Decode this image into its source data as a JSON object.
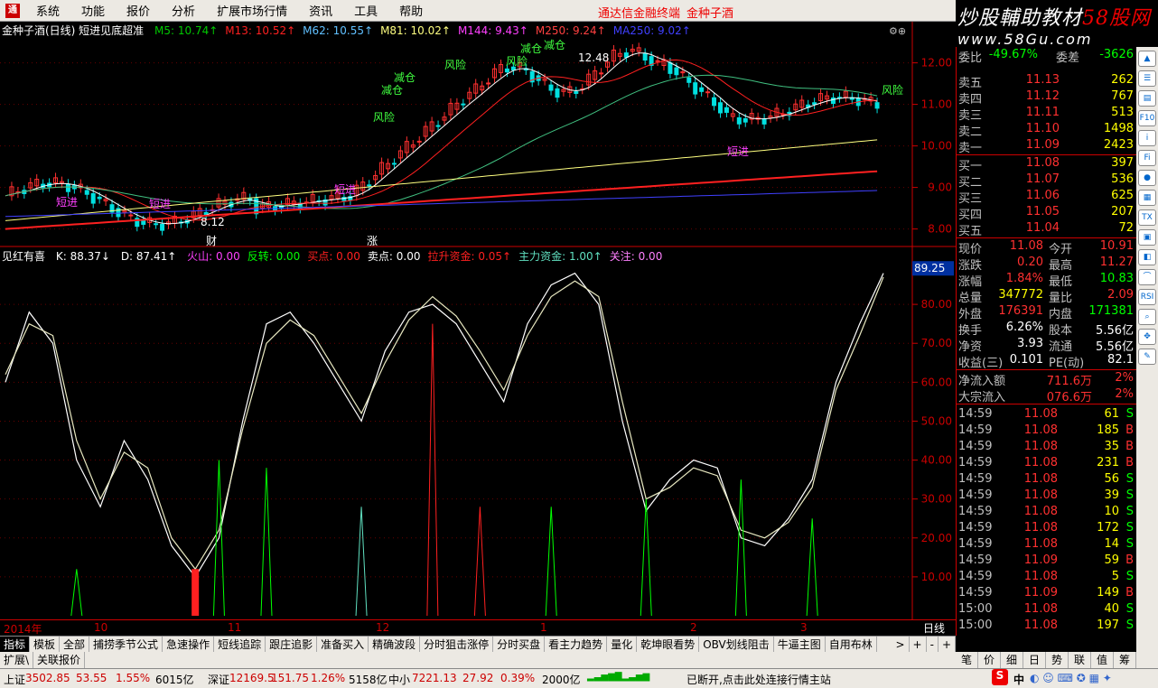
{
  "menu": {
    "logo": "通",
    "items": [
      "系统",
      "功能",
      "报价",
      "分析",
      "扩展市场行情",
      "资讯",
      "工具",
      "帮助"
    ],
    "center_text": "通达信金融终端",
    "stock_name": "金种子酒"
  },
  "watermark": {
    "line1": "炒股輔助教材",
    "line1_accent": "58股网",
    "line2": "www.58Gu.com"
  },
  "main_chart": {
    "title": "金种子酒(日线) 短进见底超准",
    "ma": [
      {
        "label": "M5: 10.74",
        "color": "#00c800"
      },
      {
        "label": "M13: 10.52",
        "color": "#ff2020"
      },
      {
        "label": "M62: 10.55",
        "color": "#60c0ff"
      },
      {
        "label": "M81: 10.02",
        "color": "#ffff80"
      },
      {
        "label": "M144: 9.43",
        "color": "#ff40ff"
      },
      {
        "label": "M250: 9.24",
        "color": "#ff4040"
      },
      {
        "label": "MA250: 9.02",
        "color": "#4040ff"
      }
    ],
    "price_axis": [
      "12.00",
      "11.00",
      "10.00",
      "9.00",
      "8.00"
    ],
    "annotations": {
      "high_label": "12.48",
      "low_label": "8.12",
      "risk1": "风险",
      "risk2": "风险",
      "risk3": "风险",
      "risk4": "风险",
      "reduce1": "减仓",
      "reduce2": "减仓",
      "reduce3": "减仓",
      "reduce4": "减仓",
      "short1": "短进",
      "short2": "短进",
      "short3": "短进",
      "short4": "短进",
      "cai": "财",
      "zhang": "涨"
    }
  },
  "indicator": {
    "name": "见红有喜",
    "k": "K: 88.37↓",
    "d": "D: 87.41↑",
    "items": [
      {
        "label": "火山: 0.00",
        "color": "#ff40ff"
      },
      {
        "label": "反转: 0.00",
        "color": "#00ff00"
      },
      {
        "label": "买点: 0.00",
        "color": "#ff2020"
      },
      {
        "label": "卖点: 0.00",
        "color": "#ffffff"
      },
      {
        "label": "拉升资金: 0.05↑",
        "color": "#ff2020"
      },
      {
        "label": "主力资金: 1.00↑",
        "color": "#60e0c0"
      },
      {
        "label": "关注: 0.00",
        "color": "#ff80ff"
      }
    ],
    "axis": [
      "80.00",
      "70.00",
      "60.00",
      "50.00",
      "40.00",
      "30.00",
      "20.00",
      "10.00"
    ],
    "current": "89.25"
  },
  "chart_data": {
    "type": "line",
    "title": "金种子酒(日线)",
    "series": [
      {
        "name": "K",
        "values": [
          60,
          78,
          70,
          40,
          28,
          45,
          35,
          18,
          10,
          20,
          50,
          75,
          78,
          70,
          60,
          50,
          68,
          78,
          80,
          75,
          65,
          55,
          75,
          85,
          88,
          80,
          50,
          27,
          35,
          40,
          38,
          20,
          18,
          25,
          35,
          60,
          75,
          88
        ]
      },
      {
        "name": "D",
        "values": [
          62,
          75,
          72,
          45,
          30,
          42,
          38,
          20,
          12,
          22,
          48,
          70,
          76,
          72,
          62,
          52,
          65,
          76,
          82,
          77,
          68,
          58,
          72,
          82,
          86,
          82,
          55,
          30,
          33,
          38,
          36,
          22,
          20,
          24,
          33,
          58,
          72,
          87
        ]
      }
    ],
    "ylim": [
      0,
      90
    ]
  },
  "quote": {
    "header": {
      "l1": "委比",
      "v1": "-49.67%",
      "l2": "委差",
      "v2": "-3626"
    },
    "sell": [
      {
        "label": "卖五",
        "price": "11.13",
        "vol": "262"
      },
      {
        "label": "卖四",
        "price": "11.12",
        "vol": "767"
      },
      {
        "label": "卖三",
        "price": "11.11",
        "vol": "513"
      },
      {
        "label": "卖二",
        "price": "11.10",
        "vol": "1498"
      },
      {
        "label": "卖一",
        "price": "11.09",
        "vol": "2423"
      }
    ],
    "buy": [
      {
        "label": "买一",
        "price": "11.08",
        "vol": "397"
      },
      {
        "label": "买二",
        "price": "11.07",
        "vol": "536"
      },
      {
        "label": "买三",
        "price": "11.06",
        "vol": "625"
      },
      {
        "label": "买四",
        "price": "11.05",
        "vol": "207"
      },
      {
        "label": "买五",
        "price": "11.04",
        "vol": "72"
      }
    ],
    "stats": [
      {
        "l1": "现价",
        "v1": "11.08",
        "l2": "今开",
        "v2": "10.91"
      },
      {
        "l1": "涨跌",
        "v1": "0.20",
        "l2": "最高",
        "v2": "11.27"
      },
      {
        "l1": "涨幅",
        "v1": "1.84%",
        "l2": "最低",
        "v2": "10.83"
      },
      {
        "l1": "总量",
        "v1": "347772",
        "l2": "量比",
        "v2": "2.09"
      },
      {
        "l1": "外盘",
        "v1": "176391",
        "l2": "内盘",
        "v2": "171381"
      },
      {
        "l1": "换手",
        "v1": "6.26%",
        "l2": "股本",
        "v2": "5.56亿"
      },
      {
        "l1": "净资",
        "v1": "3.93",
        "l2": "流通",
        "v2": "5.56亿"
      },
      {
        "l1": "收益(三)",
        "v1": "0.101",
        "l2": "PE(动)",
        "v2": "82.1"
      }
    ],
    "flow": [
      {
        "label": "净流入额",
        "value": "711.6万",
        "pct": "2%"
      },
      {
        "label": "大宗流入",
        "value": "076.6万",
        "pct": "2%"
      }
    ],
    "ticks": [
      {
        "time": "14:59",
        "price": "11.08",
        "vol": "61",
        "bs": "S"
      },
      {
        "time": "14:59",
        "price": "11.08",
        "vol": "185",
        "bs": "B"
      },
      {
        "time": "14:59",
        "price": "11.08",
        "vol": "35",
        "bs": "B"
      },
      {
        "time": "14:59",
        "price": "11.08",
        "vol": "231",
        "bs": "B"
      },
      {
        "time": "14:59",
        "price": "11.08",
        "vol": "56",
        "bs": "S"
      },
      {
        "time": "14:59",
        "price": "11.08",
        "vol": "39",
        "bs": "S"
      },
      {
        "time": "14:59",
        "price": "11.08",
        "vol": "10",
        "bs": "S"
      },
      {
        "time": "14:59",
        "price": "11.08",
        "vol": "172",
        "bs": "S"
      },
      {
        "time": "14:59",
        "price": "11.08",
        "vol": "14",
        "bs": "S"
      },
      {
        "time": "14:59",
        "price": "11.09",
        "vol": "59",
        "bs": "B"
      },
      {
        "time": "14:59",
        "price": "11.08",
        "vol": "5",
        "bs": "S"
      },
      {
        "time": "14:59",
        "price": "11.09",
        "vol": "149",
        "bs": "B"
      },
      {
        "time": "15:00",
        "price": "11.08",
        "vol": "40",
        "bs": "S"
      },
      {
        "time": "15:00",
        "price": "11.08",
        "vol": "197",
        "bs": "S"
      }
    ]
  },
  "time_axis": {
    "labels": [
      "2014年",
      "10",
      "11",
      "12",
      "1",
      "2",
      "3"
    ],
    "period": "日线"
  },
  "tabs": {
    "items": [
      "指标",
      "模板",
      "全部",
      "捕捞季节公式",
      "急速操作",
      "短线追踪",
      "跟庄追影",
      "准备买入",
      "精确波段",
      "分时狙击涨停",
      "分时买盘",
      "看主力趋势",
      "量化",
      "乾坤眼看势",
      "OBV划线阻击",
      "牛逼主图",
      "自用布林"
    ],
    "more": ">",
    "controls": [
      "+",
      "-",
      "+"
    ]
  },
  "tabs2": [
    "扩展\\",
    "关联报价"
  ],
  "rtabs": [
    "笔",
    "价",
    "细",
    "日",
    "势",
    "联",
    "值",
    "筹"
  ],
  "status": {
    "sh_label": "上证",
    "sh_val": "3502.85",
    "sh_chg": "53.55",
    "sh_pct": "1.55%",
    "sh_amt": "6015亿",
    "sz_label": "深证",
    "sz_val": "12169.5",
    "sz_chg": "151.75",
    "sz_pct": "1.26%",
    "sz_amt": "5158亿",
    "zx_label": "中小",
    "zx_val": "7221.13",
    "zx_chg": "27.92",
    "zx_pct": "0.39%",
    "zx_amt": "2000亿",
    "msg": "已断开,点击此处连接行情主站",
    "ime": "中"
  }
}
